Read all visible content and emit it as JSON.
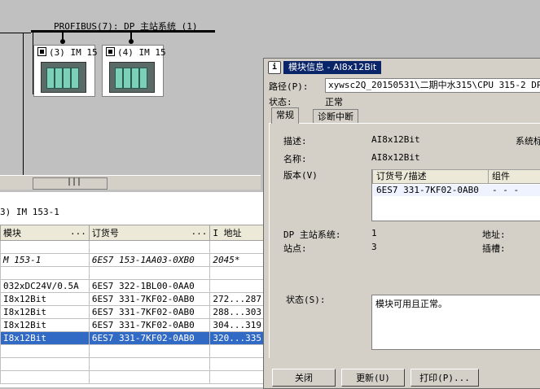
{
  "network": {
    "bus_label": "PROFIBUS(7): DP 主站系统 (1)",
    "stations": [
      {
        "label": "(3) IM 15"
      },
      {
        "label": "(4) IM 15"
      }
    ]
  },
  "lower_pane": {
    "title": "3)  IM 153-1",
    "columns": [
      "模块",
      "订货号",
      "I 地址"
    ],
    "rows": [
      {
        "module": "",
        "order": "",
        "addr": ""
      },
      {
        "module": "M 153-1",
        "order": "6ES7 153-1AA03-0XB0",
        "addr": "2045*"
      },
      {
        "module": "",
        "order": "",
        "addr": ""
      },
      {
        "module": "032xDC24V/0.5A",
        "order": "6ES7 322-1BL00-0AA0",
        "addr": ""
      },
      {
        "module": "I8x12Bit",
        "order": "6ES7 331-7KF02-0AB0",
        "addr": "272...287"
      },
      {
        "module": "I8x12Bit",
        "order": "6ES7 331-7KF02-0AB0",
        "addr": "288...303"
      },
      {
        "module": "I8x12Bit",
        "order": "6ES7 331-7KF02-0AB0",
        "addr": "304...319"
      },
      {
        "module": "I8x12Bit",
        "order": "6ES7 331-7KF02-0AB0",
        "addr": "320...335"
      },
      {
        "module": "",
        "order": "",
        "addr": ""
      },
      {
        "module": "",
        "order": "",
        "addr": ""
      },
      {
        "module": "",
        "order": "",
        "addr": ""
      }
    ]
  },
  "dialog": {
    "title": "模块信息 - AI8x12Bit",
    "path_label": "路径(P):",
    "path_value": "xywsc2Q_20150531\\二期中水315\\CPU 315-2 DP",
    "state_label": "状态:",
    "state_value": "正常",
    "tabs": [
      "常规",
      "诊断中断"
    ],
    "desc_label": "描述:",
    "desc_value": "AI8x12Bit",
    "sys_label": "系统标",
    "name_label": "名称:",
    "name_value": "AI8x12Bit",
    "version_label": "版本(V)",
    "version_columns": [
      "订货号/描述",
      "组件"
    ],
    "version_row": {
      "order": "6ES7 331-7KF02-0AB0",
      "component": "- - -"
    },
    "dp_label": "DP 主站系统:",
    "dp_value": "1",
    "addr_label": "地址:",
    "station_label": "站点:",
    "station_value": "3",
    "slot_label": "插槽:",
    "status_label": "状态(S):",
    "status_value": "模块可用且正常。",
    "buttons": {
      "close": "关闭",
      "update": "更新(U)",
      "print": "打印(P)..."
    }
  }
}
